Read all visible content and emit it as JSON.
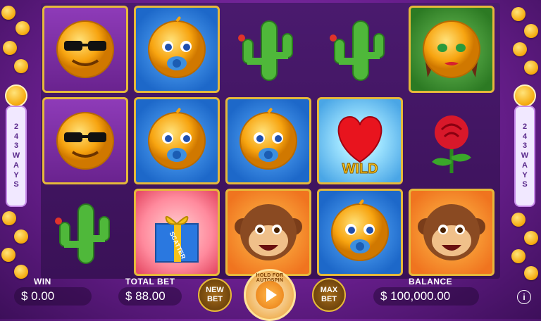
{
  "side_label_chars": [
    "2",
    "4",
    "3",
    "W",
    "A",
    "Y",
    "S"
  ],
  "reels": {
    "cells": [
      {
        "symbol": "cool-sunglasses-emoji",
        "bg": "purple",
        "framed": true
      },
      {
        "symbol": "baby-pacifier-emoji",
        "bg": "blue",
        "framed": true
      },
      {
        "symbol": "cactus",
        "bg": "none",
        "framed": false
      },
      {
        "symbol": "cactus",
        "bg": "none",
        "framed": false
      },
      {
        "symbol": "lady-emoji",
        "bg": "green",
        "framed": true
      },
      {
        "symbol": "cool-sunglasses-emoji",
        "bg": "purple",
        "framed": true
      },
      {
        "symbol": "baby-pacifier-emoji",
        "bg": "blue",
        "framed": true
      },
      {
        "symbol": "baby-pacifier-emoji",
        "bg": "blue",
        "framed": true
      },
      {
        "symbol": "wild-heart",
        "bg": "wild",
        "framed": true,
        "label": "WILD"
      },
      {
        "symbol": "rose",
        "bg": "none",
        "framed": false
      },
      {
        "symbol": "cactus",
        "bg": "none",
        "framed": false
      },
      {
        "symbol": "scatter-gift",
        "bg": "scatter",
        "framed": true,
        "label": "SCATTER"
      },
      {
        "symbol": "monkey-emoji",
        "bg": "orange",
        "framed": true
      },
      {
        "symbol": "baby-pacifier-emoji",
        "bg": "blue",
        "framed": true
      },
      {
        "symbol": "monkey-emoji",
        "bg": "orange",
        "framed": true
      }
    ]
  },
  "bottom": {
    "win_label": "WIN",
    "win_value": "$ 0.00",
    "total_bet_label": "TOTAL BET",
    "total_bet_value": "$ 88.00",
    "new_bet_line1": "NEW",
    "new_bet_line2": "BET",
    "spin_hint": "HOLD FOR AUTOSPIN",
    "max_bet_line1": "MAX",
    "max_bet_line2": "BET",
    "balance_label": "BALANCE",
    "balance_value": "$ 100,000.00",
    "info_glyph": "i"
  }
}
